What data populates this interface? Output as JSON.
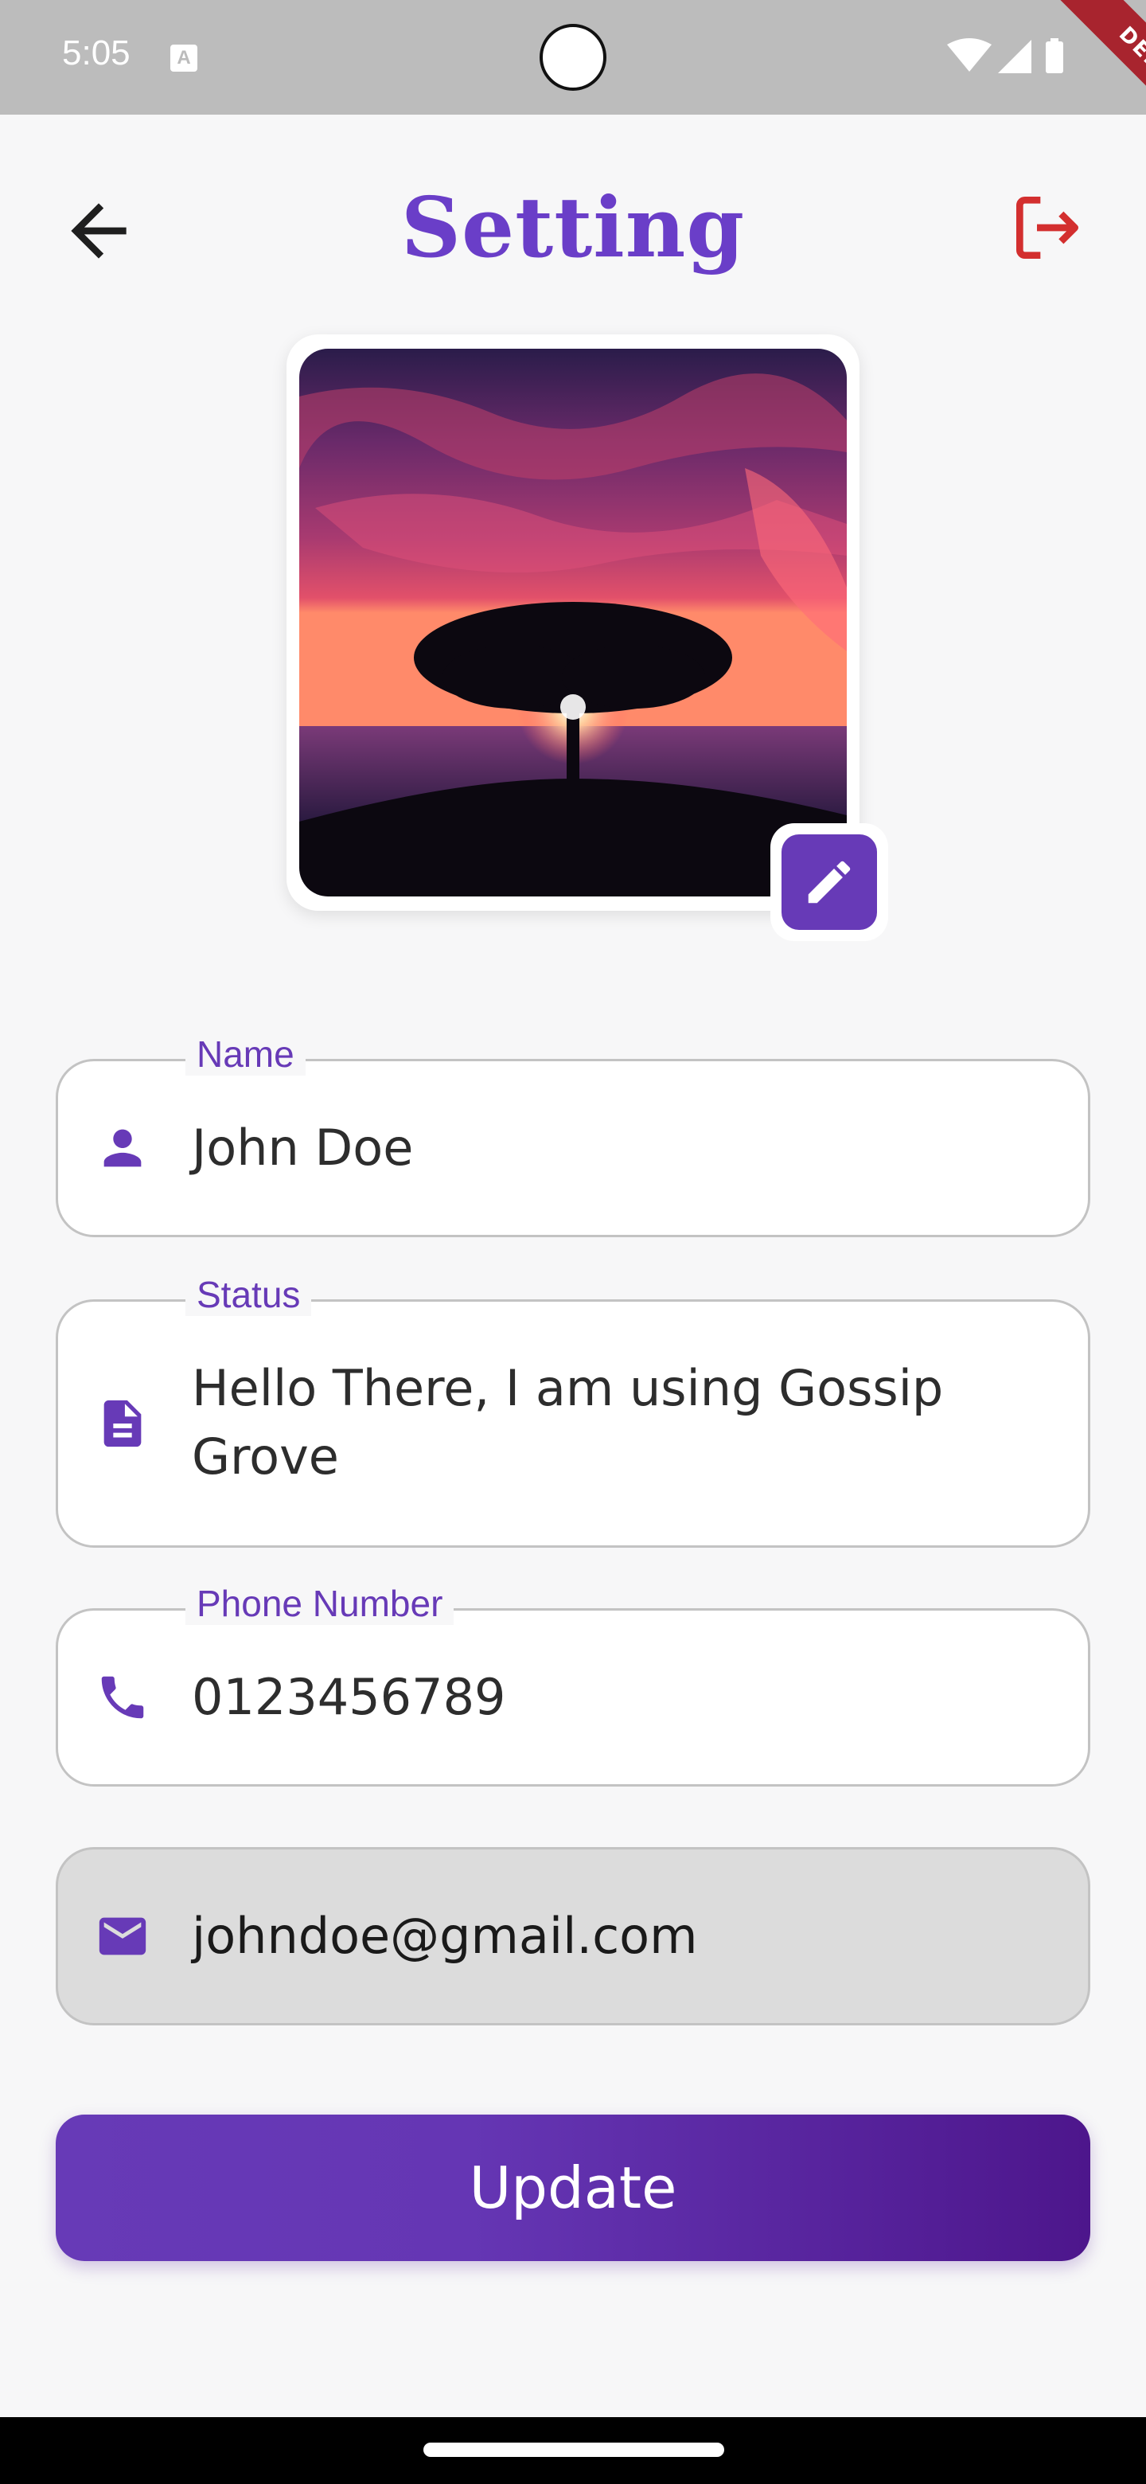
{
  "status_bar": {
    "time": "5:05",
    "notification_icon": "A",
    "debug_banner": "DEBUG"
  },
  "app_bar": {
    "title": "Setting",
    "back_icon": "arrow-back-icon",
    "logout_icon": "logout-icon",
    "logout_color": "#d32f2f",
    "title_color": "#673ab7"
  },
  "profile": {
    "edit_icon": "pencil-icon"
  },
  "form": {
    "name": {
      "label": "Name",
      "value": "John Doe",
      "icon": "person-icon"
    },
    "status": {
      "label": "Status",
      "value": "Hello There, I am using Gossip Grove",
      "icon": "document-icon"
    },
    "phone": {
      "label": "Phone Number",
      "value": "0123456789",
      "icon": "phone-icon"
    },
    "email": {
      "value": "johndoe@gmail.com",
      "icon": "mail-icon",
      "disabled": true
    }
  },
  "update_button": {
    "label": "Update"
  },
  "colors": {
    "accent": "#673ab7",
    "accent_dark": "#4a148c",
    "background": "#f7f7f8"
  }
}
